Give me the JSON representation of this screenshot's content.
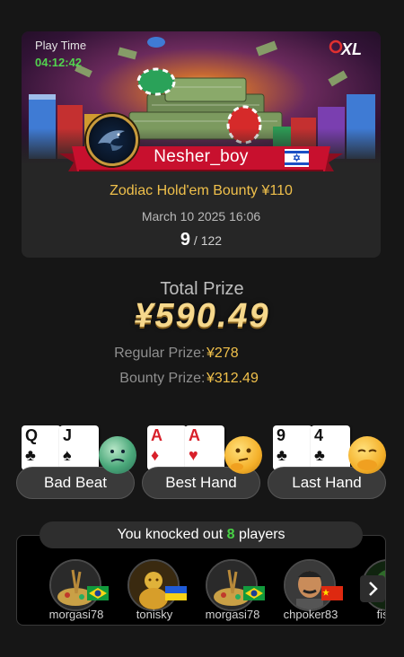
{
  "header": {
    "play_time_label": "Play Time",
    "play_time_value": "04:12:42",
    "brand": "XL"
  },
  "player": {
    "name": "Nesher_boy",
    "flag": "Israel",
    "avatar": "eagle-avatar"
  },
  "tournament": {
    "name": "Zodiac Hold'em Bounty ¥110",
    "date": "March 10 2025 16:06",
    "place": "9",
    "separator": " / ",
    "entrants": "122"
  },
  "prize": {
    "total_label": "Total Prize",
    "total_value": "¥590.49",
    "regular_label": "Regular Prize",
    "regular_value": "¥278",
    "bounty_label": "Bounty Prize",
    "bounty_value": "¥312.49",
    "colon": ":"
  },
  "highlights": [
    {
      "label": "Bad Beat",
      "cards": [
        {
          "rank": "Q",
          "suit": "♣",
          "color": "black"
        },
        {
          "rank": "J",
          "suit": "♠",
          "color": "black"
        }
      ],
      "emoji": "sick-face-emoji"
    },
    {
      "label": "Best Hand",
      "cards": [
        {
          "rank": "A",
          "suit": "♦",
          "color": "red"
        },
        {
          "rank": "A",
          "suit": "♥",
          "color": "red"
        }
      ],
      "emoji": "thinking-face-emoji"
    },
    {
      "label": "Last Hand",
      "cards": [
        {
          "rank": "9",
          "suit": "♣",
          "color": "black"
        },
        {
          "rank": "4",
          "suit": "♣",
          "color": "black"
        }
      ],
      "emoji": "face-with-hand-emoji"
    }
  ],
  "knockouts": {
    "prefix": "You knocked out ",
    "count": "8",
    "suffix": " players",
    "players": [
      {
        "name": "morgasi78",
        "flag": "Brazil"
      },
      {
        "name": "tonisky",
        "flag": "Ukraine"
      },
      {
        "name": "morgasi78",
        "flag": "Brazil"
      },
      {
        "name": "chpoker83",
        "flag": "China"
      },
      {
        "name": "fisch",
        "flag": ""
      }
    ]
  },
  "colors": {
    "background": "#161616",
    "gold": "#f0c04b",
    "green": "#52d34e",
    "ribbon_red": "#c8102e"
  }
}
